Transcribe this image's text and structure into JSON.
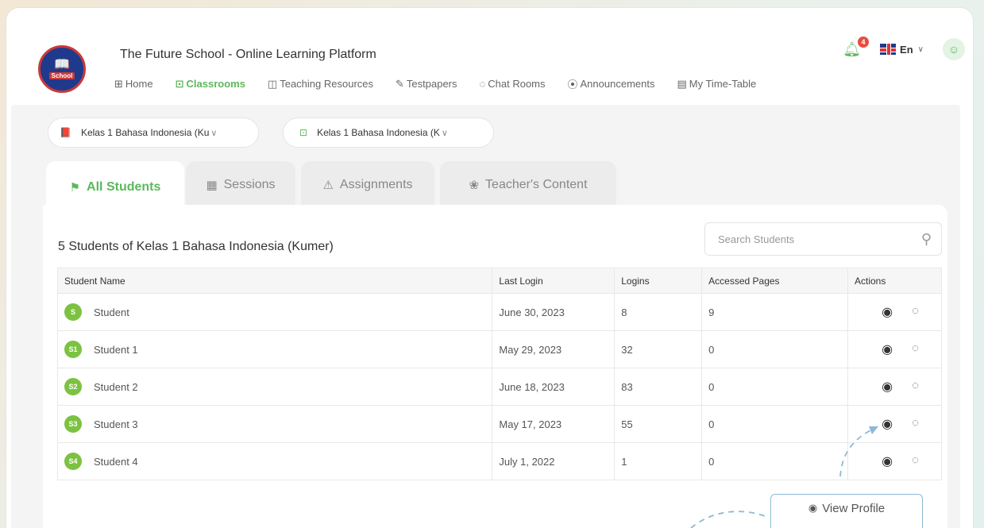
{
  "header": {
    "logo_text": "School",
    "title": "The Future School - Online Learning Platform",
    "notification_count": "4",
    "language": "En"
  },
  "nav": [
    {
      "label": "Home",
      "icon": "home-icon",
      "glyph": "⊞",
      "active": false
    },
    {
      "label": "Classrooms",
      "icon": "classroom-icon",
      "glyph": "⊡",
      "active": true
    },
    {
      "label": "Teaching Resources",
      "icon": "book-icon",
      "glyph": "◫",
      "active": false
    },
    {
      "label": "Testpapers",
      "icon": "testpaper-icon",
      "glyph": "✎",
      "active": false
    },
    {
      "label": "Chat Rooms",
      "icon": "chat-icon",
      "glyph": "◌",
      "active": false
    },
    {
      "label": "Announcements",
      "icon": "megaphone-icon",
      "glyph": "⦿",
      "active": false
    },
    {
      "label": "My Time-Table",
      "icon": "calendar-icon",
      "glyph": "▤",
      "active": false
    }
  ],
  "selectors": {
    "subject": "Kelas 1 Bahasa Indonesia (Ku",
    "class": "Kelas 1 Bahasa Indonesia (K"
  },
  "tabs": [
    {
      "label": "All Students",
      "active": true
    },
    {
      "label": "Sessions",
      "active": false
    },
    {
      "label": "Assignments",
      "active": false
    },
    {
      "label": "Teacher's Content",
      "active": false
    }
  ],
  "panel": {
    "title": "5 Students of Kelas 1 Bahasa Indonesia (Kumer)",
    "search_placeholder": "Search Students"
  },
  "table": {
    "columns": [
      "Student Name",
      "Last Login",
      "Logins",
      "Accessed Pages",
      "Actions"
    ],
    "rows": [
      {
        "initials": "S",
        "name": "Student",
        "last_login": "June 30, 2023",
        "logins": "8",
        "pages": "9"
      },
      {
        "initials": "S1",
        "name": "Student 1",
        "last_login": "May 29, 2023",
        "logins": "32",
        "pages": "0"
      },
      {
        "initials": "S2",
        "name": "Student 2",
        "last_login": "June 18, 2023",
        "logins": "83",
        "pages": "0"
      },
      {
        "initials": "S3",
        "name": "Student 3",
        "last_login": "May 17, 2023",
        "logins": "55",
        "pages": "0"
      },
      {
        "initials": "S4",
        "name": "Student 4",
        "last_login": "July 1, 2022",
        "logins": "1",
        "pages": "0"
      }
    ]
  },
  "callout": {
    "label": "View Profile"
  },
  "colors": {
    "accent": "#5cb85c",
    "avatar": "#7cc242",
    "badge": "#e74c3c",
    "callout_border": "#8bbad6"
  }
}
